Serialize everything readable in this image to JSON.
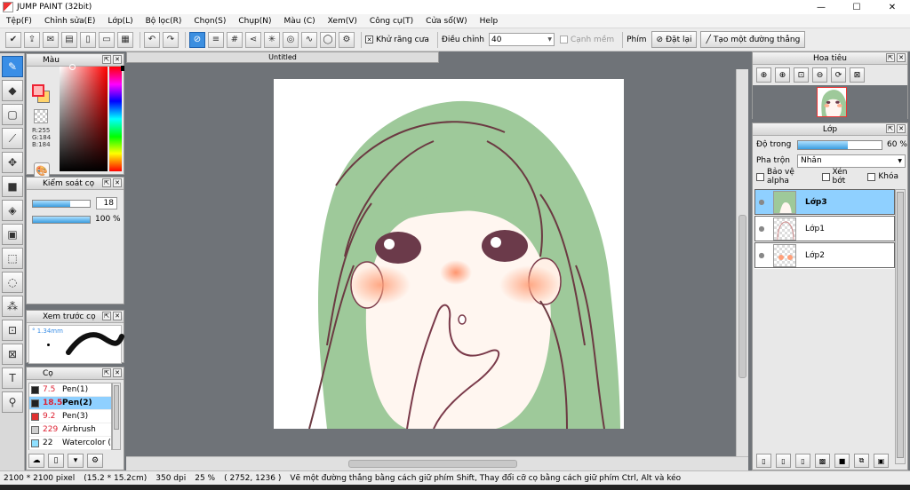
{
  "window": {
    "title": "JUMP PAINT (32bit)",
    "min": "—",
    "max": "☐",
    "close": "✕"
  },
  "menu": [
    "Tệp(F)",
    "Chỉnh sửa(E)",
    "Lớp(L)",
    "Bộ lọc(R)",
    "Chọn(S)",
    "Chụp(N)",
    "Màu (C)",
    "Xem(V)",
    "Công cụ(T)",
    "Cửa sổ(W)",
    "Help"
  ],
  "toolbar": {
    "antialias_label": "Khử răng cưa",
    "antialias_checked": "✕",
    "adjust_label": "Điều chỉnh",
    "adjust_value": "40",
    "sharp_label": "Cạnh mềm",
    "key_label": "Phím",
    "reset_button": "Đặt lại",
    "line_button": "Tạo một đường thẳng"
  },
  "document": {
    "tab_title": "Untitled"
  },
  "color_panel": {
    "title": "Màu",
    "r": "R:255",
    "g": "G:184",
    "b": "B:184",
    "fg_color": "#ffb8b8",
    "bg_color": "#ffd36b"
  },
  "brush_control": {
    "title": "Kiểm soát cọ",
    "size": "18",
    "size_fill": 0.65,
    "opacity": "100 %",
    "opacity_fill": 1.0
  },
  "brush_preview": {
    "title": "Xem trước cọ",
    "size_mm": "° 1.34mm"
  },
  "brushes": {
    "title": "Cọ",
    "items": [
      {
        "size": "7.5",
        "name": "Pen(1)",
        "color": "#222222"
      },
      {
        "size": "18.5",
        "name": "Pen(2)",
        "color": "#222222"
      },
      {
        "size": "9.2",
        "name": "Pen(3)",
        "color": "#e03030"
      },
      {
        "size": "229",
        "name": "Airbrush",
        "color": "#cfcfcf"
      },
      {
        "size": "22",
        "name": "Watercolor (",
        "color": "#8fe0ff"
      }
    ]
  },
  "navigator": {
    "title": "Hoa tiêu"
  },
  "layers": {
    "title": "Lớp",
    "opacity_label": "Độ trong",
    "opacity_value": "60 %",
    "opacity_fill": 0.6,
    "blend_label": "Pha trộn",
    "blend_value": "Nhân",
    "protect_alpha": "Bảo vệ alpha",
    "clipping": "Xén bớt",
    "lock": "Khóa",
    "items": [
      {
        "name": "Lớp3"
      },
      {
        "name": "Lớp1"
      },
      {
        "name": "Lớp2"
      }
    ]
  },
  "status": {
    "size": "2100 * 2100 pixel",
    "cm": "(15.2 * 15.2cm)",
    "dpi": "350 dpi",
    "zoom": "25 %",
    "coords": "( 2752, 1236 )",
    "hint": "Vẽ một đường thẳng bằng cách giữ phím Shift, Thay đổi cỡ cọ bằng cách giữ phím Ctrl, Alt và kéo"
  }
}
